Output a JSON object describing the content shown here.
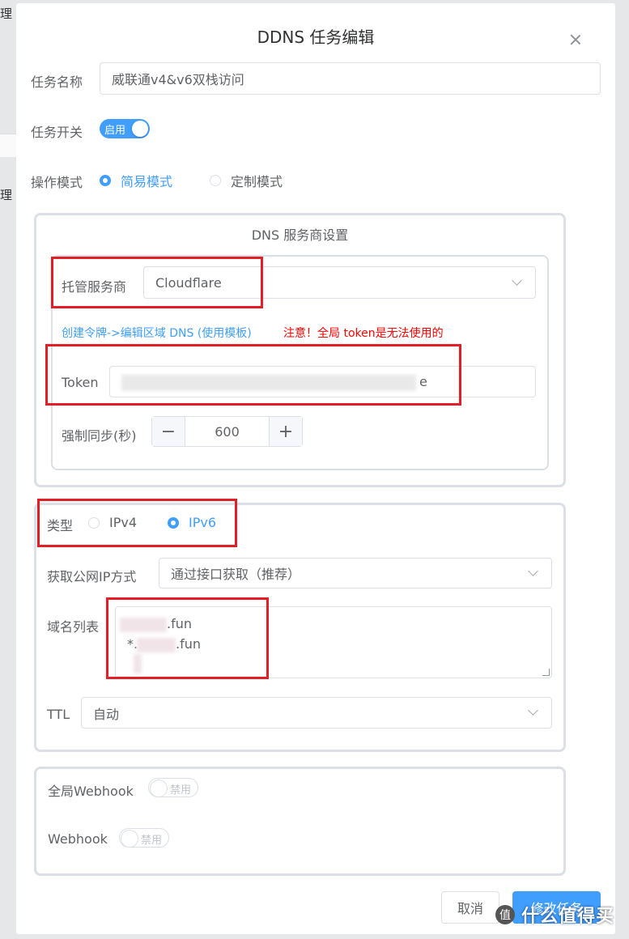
{
  "background": {
    "left_text_1": "理",
    "left_text_2": "理"
  },
  "dialog": {
    "title": "DDNS 任务编辑",
    "close_icon": "close-icon"
  },
  "form": {
    "task_name_label": "任务名称",
    "task_name_value": "威联通v4&v6双栈访问",
    "task_switch_label": "任务开关",
    "task_switch_text": "启用",
    "task_switch_on": true,
    "mode_label": "操作模式",
    "mode_simple": "简易模式",
    "mode_custom": "定制模式",
    "mode_selected": "简易模式"
  },
  "dns_panel": {
    "title": "DNS 服务商设置",
    "provider_label": "托管服务商",
    "provider_value": "Cloudflare",
    "help_link": "创建令牌->编辑区域 DNS (使用模板)",
    "warning": "注意！全局 token是无法使用的",
    "token_label": "Token",
    "token_visible_tail": "e",
    "sync_label": "强制同步(秒)",
    "sync_value": "600",
    "minus_icon": "minus-icon",
    "plus_icon": "plus-icon"
  },
  "ip_panel": {
    "type_label": "类型",
    "ipv4": "IPv4",
    "ipv6": "IPv6",
    "type_selected": "IPv6",
    "method_label": "获取公网IP方式",
    "method_value": "通过接口获取（推荐）",
    "domains_label": "域名列表",
    "domain_1_suffix": ".fun",
    "domain_2_prefix": "*.",
    "domain_2_suffix": ".fun",
    "ttl_label": "TTL",
    "ttl_value": "自动"
  },
  "webhook_panel": {
    "global_label": "全局Webhook",
    "global_switch_text": "禁用",
    "webhook_label": "Webhook",
    "webhook_switch_text": "禁用"
  },
  "footer": {
    "cancel": "取消",
    "submit": "修改任务"
  },
  "watermark": {
    "badge": "值",
    "text": "什么值得买"
  },
  "colors": {
    "primary": "#409eff",
    "annotation_red": "#e21e26",
    "warning_red": "#ff0000"
  }
}
